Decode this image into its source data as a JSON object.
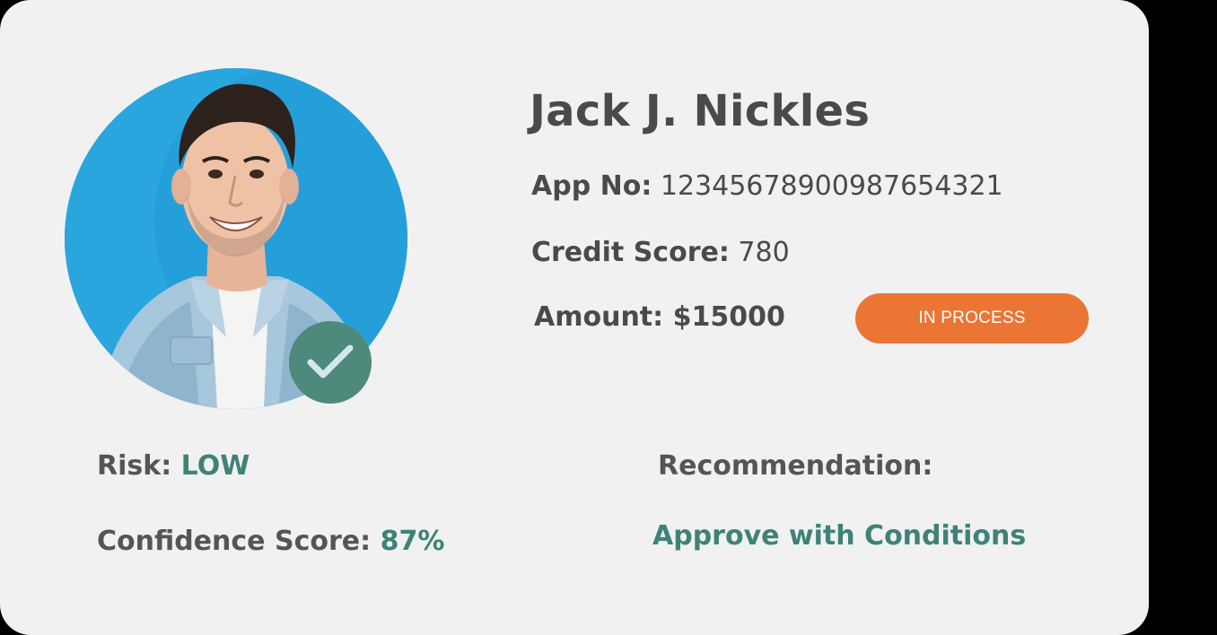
{
  "applicant": {
    "name": "Jack J. Nickles",
    "avatar_alt": "Applicant photo",
    "verified_icon": "check-icon"
  },
  "details": {
    "app_no_label": "App No:",
    "app_no_value": "12345678900987654321",
    "credit_label": "Credit Score:",
    "credit_value": "780",
    "amount_label": "Amount:",
    "amount_value": "$15000"
  },
  "status": {
    "label": "IN PROCESS",
    "color": "#ea7535"
  },
  "assessment": {
    "risk_label": "Risk:",
    "risk_value": "LOW",
    "confidence_label": "Confidence Score:",
    "confidence_value": "87%",
    "recommendation_label": "Recommendation:",
    "recommendation_value": "Approve with Conditions",
    "accent_color": "#3f8277"
  }
}
